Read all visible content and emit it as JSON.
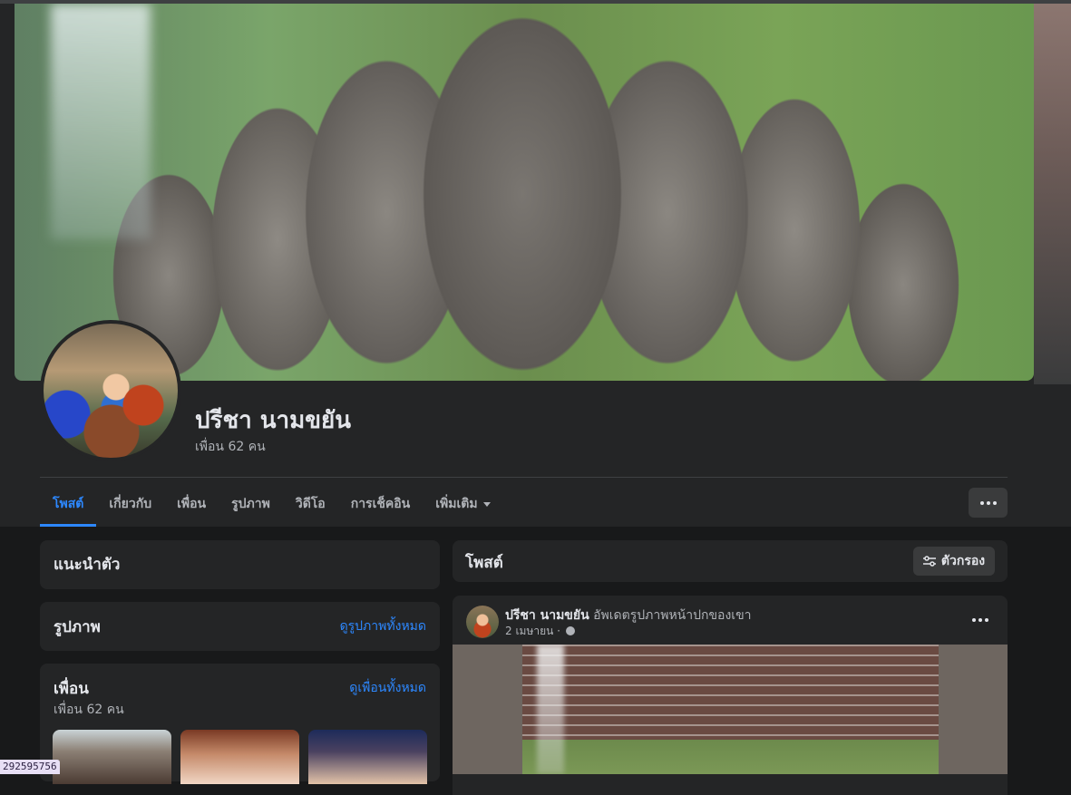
{
  "profile": {
    "name": "ปรีชา นามขยัน",
    "friend_count": "เพื่อน 62 คน"
  },
  "tabs": [
    {
      "label": "โพสต์",
      "active": true
    },
    {
      "label": "เกี่ยวกับ",
      "active": false
    },
    {
      "label": "เพื่อน",
      "active": false
    },
    {
      "label": "รูปภาพ",
      "active": false
    },
    {
      "label": "วิดีโอ",
      "active": false
    },
    {
      "label": "การเช็คอิน",
      "active": false
    },
    {
      "label": "เพิ่มเติม",
      "active": false
    }
  ],
  "left": {
    "intro_title": "แนะนำตัว",
    "photos_title": "รูปภาพ",
    "photos_link": "ดูรูปภาพทั้งหมด",
    "friends_title": "เพื่อน",
    "friends_link": "ดูเพื่อนทั้งหมด",
    "friends_count": "เพื่อน 62 คน"
  },
  "posts_header": {
    "title": "โพสต์",
    "filter_label": "ตัวกรอง"
  },
  "post": {
    "author": "ปรีชา นามขยัน",
    "action": "อัพเดตรูปภาพหน้าปกของเขา",
    "date": "2 เมษายน ·"
  },
  "status_chip": "292595756",
  "colors": {
    "accent": "#2d88ff",
    "card_bg": "#242526",
    "page_bg": "#18191a"
  }
}
